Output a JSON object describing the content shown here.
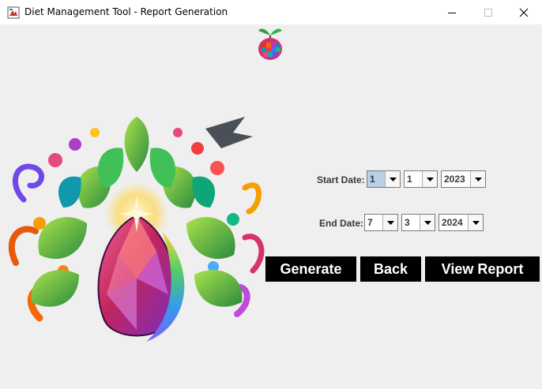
{
  "window": {
    "title": "Diet Management Tool - Report Generation"
  },
  "form": {
    "start": {
      "label": "Start Date:",
      "day": "1",
      "month": "1",
      "year": "2023"
    },
    "end": {
      "label": "End Date:",
      "day": "7",
      "month": "3",
      "year": "2024"
    }
  },
  "buttons": {
    "generate": "Generate",
    "back": "Back",
    "view_report": "View Report"
  },
  "colors": {
    "button_bg": "#000000",
    "button_text": "#ffffff",
    "window_bg": "#efefef",
    "label_text": "#333a40",
    "focused_combo": "#b8cfe5"
  },
  "icons": [
    "app-icon",
    "minimize-icon",
    "maximize-icon",
    "close-icon",
    "apple-logo-icon",
    "crystal-egg-illustration",
    "chevron-down-icon"
  ]
}
